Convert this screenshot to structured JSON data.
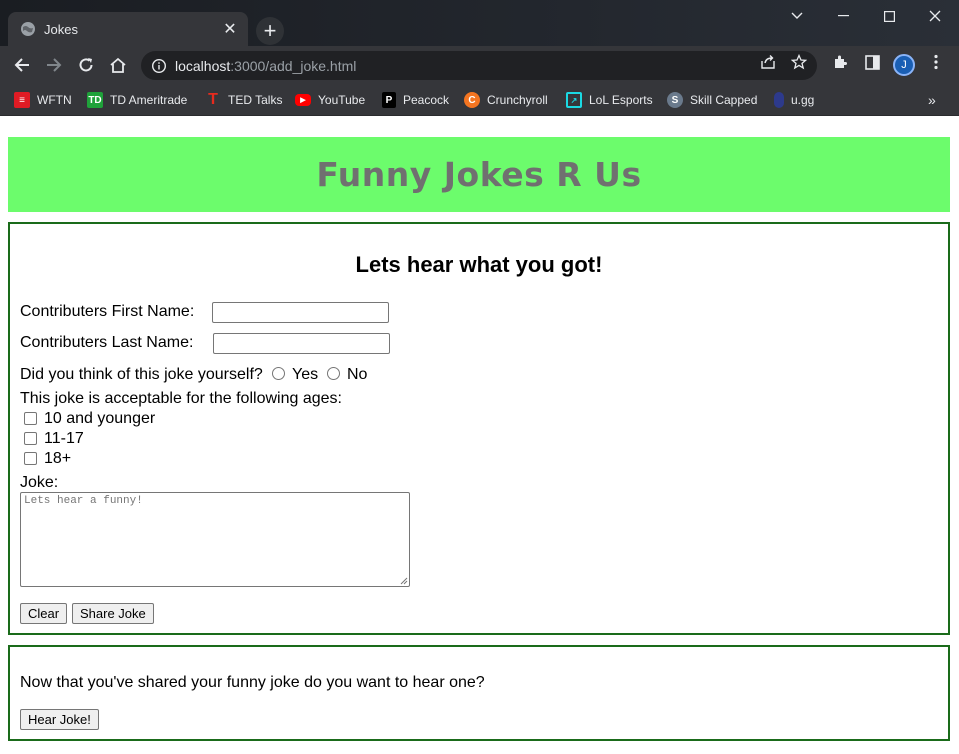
{
  "browser": {
    "tab_title": "Jokes",
    "url_host": "localhost",
    "url_path": ":3000/add_joke.html",
    "avatar_letter": "J",
    "bookmarks": [
      {
        "label": "WFTN",
        "icon": "wftn-icon",
        "color": "#e01b24"
      },
      {
        "label": "TD Ameritrade",
        "icon": "td-icon",
        "color": "#1fa23a"
      },
      {
        "label": "TED Talks",
        "icon": "ted-icon",
        "color": "#e62b1e"
      },
      {
        "label": "YouTube",
        "icon": "youtube-icon",
        "color": "#ff0000"
      },
      {
        "label": "Peacock",
        "icon": "peacock-icon",
        "color": "#000000"
      },
      {
        "label": "Crunchyroll",
        "icon": "crunchyroll-icon",
        "color": "#f47521"
      },
      {
        "label": "LoL Esports",
        "icon": "lol-esports-icon",
        "color": "#1bd9e3"
      },
      {
        "label": "Skill Capped",
        "icon": "skill-capped-icon",
        "color": "#6a7a8c"
      },
      {
        "label": "u.gg",
        "icon": "ugg-icon",
        "color": "#2d3a8c"
      }
    ]
  },
  "page": {
    "banner_title": "Funny Jokes R Us",
    "form": {
      "heading": "Lets hear what you got!",
      "first_name_label": "Contributers First Name:",
      "first_name_value": "",
      "last_name_label": "Contributers Last Name:",
      "last_name_value": "",
      "own_joke_question": "Did you think of this joke yourself?",
      "yes_label": "Yes",
      "no_label": "No",
      "ages_label": "This joke is acceptable for the following ages:",
      "age_options": [
        "10 and younger",
        "11-17",
        "18+"
      ],
      "joke_label": "Joke:",
      "joke_placeholder": "Lets hear a funny!",
      "clear_button": "Clear",
      "share_button": "Share Joke"
    },
    "hear": {
      "prompt": "Now that you've shared your funny joke do you want to hear one?",
      "button": "Hear Joke!"
    }
  },
  "colors": {
    "banner_bg": "#6cfc6c",
    "banner_text": "#707070",
    "box_border": "#1a6b1a"
  }
}
